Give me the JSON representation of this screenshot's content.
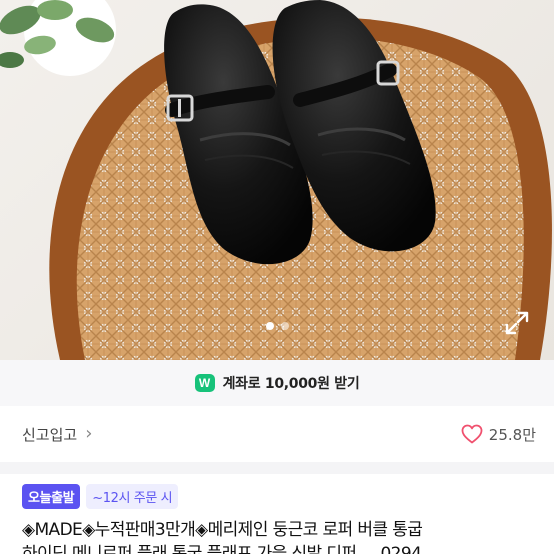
{
  "gallery": {
    "image_alt": "black loafers with buckle strap on rattan chair",
    "dots": 2,
    "active_dot": 1,
    "expand_icon": "expand-icon"
  },
  "promo": {
    "badge": "W",
    "text": "계좌로 10,000원 받기",
    "badge_color": "#17c27a"
  },
  "seller": {
    "name": "신고입고",
    "chevron": "›",
    "like_icon": "heart-icon",
    "likes": "25.8만"
  },
  "delivery": {
    "badge": "오늘출발",
    "note": "~12시 주문 시",
    "accent": "#5b53f1"
  },
  "product": {
    "title_line1": "◈MADE◈누적판매3만개◈메리제인 둥근코 로퍼 버클 통굽",
    "title_line2": "하이딘 메니로퍼 플래 통굽 플래프 가을 신발 디퍼 ... 0294"
  }
}
